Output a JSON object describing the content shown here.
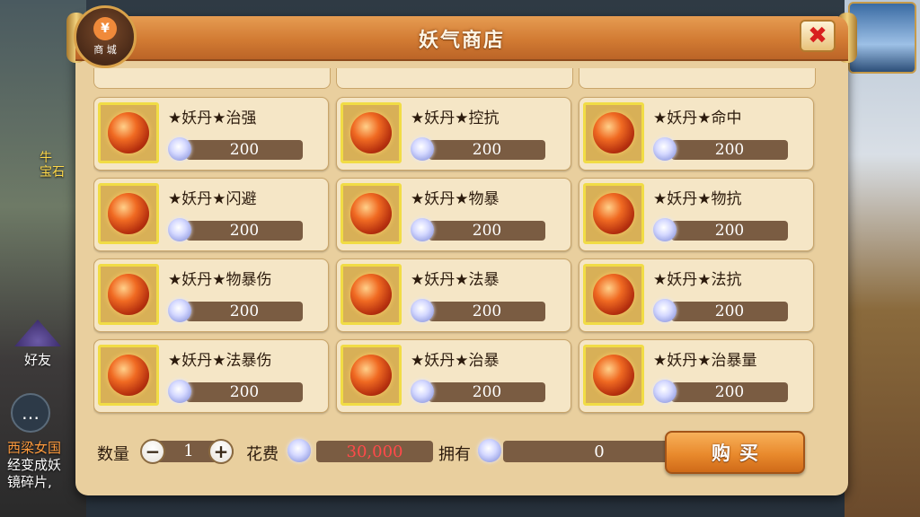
{
  "background": {
    "friend_label": "好友",
    "npc_tag": "牛\n宝石",
    "chat_lines": [
      "西梁女国",
      "经变成妖",
      "镜碎片,"
    ]
  },
  "shop": {
    "title": "妖气商店",
    "logo_text": "商 城",
    "logo_symbol": "¥",
    "close_symbol": "✖",
    "currency_icon": "spirit-gem-icon",
    "item_icon": "demon-pill-icon",
    "items": [
      {
        "name": "★妖丹★治强",
        "price": "200"
      },
      {
        "name": "★妖丹★控抗",
        "price": "200"
      },
      {
        "name": "★妖丹★命中",
        "price": "200"
      },
      {
        "name": "★妖丹★闪避",
        "price": "200"
      },
      {
        "name": "★妖丹★物暴",
        "price": "200"
      },
      {
        "name": "★妖丹★物抗",
        "price": "200"
      },
      {
        "name": "★妖丹★物暴伤",
        "price": "200"
      },
      {
        "name": "★妖丹★法暴",
        "price": "200"
      },
      {
        "name": "★妖丹★法抗",
        "price": "200"
      },
      {
        "name": "★妖丹★法暴伤",
        "price": "200"
      },
      {
        "name": "★妖丹★治暴",
        "price": "200"
      },
      {
        "name": "★妖丹★治暴量",
        "price": "200"
      }
    ]
  },
  "purchase": {
    "quantity_label": "数量",
    "minus_symbol": "−",
    "quantity_value": "1",
    "plus_symbol": "+",
    "cost_label": "花费",
    "cost_value": "30,000",
    "owned_label": "拥有",
    "owned_value": "0",
    "buy_label": "购买"
  },
  "colors": {
    "panel": "#e9cf9e",
    "header": "#d27b33",
    "price_bar": "#7a5c42",
    "cost_text": "#ff4a4a",
    "buy_button": "#e98a2d"
  }
}
